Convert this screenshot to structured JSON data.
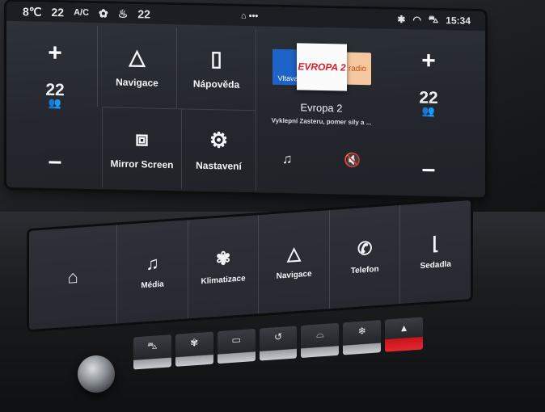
{
  "status_bar": {
    "outside_temp": "8℃",
    "left_temp": "22",
    "ac_label": "A/C",
    "fan_icon": "fan-icon",
    "seat_heat_icon": "seat-heat-icon",
    "right_temp": "22",
    "home_icon": "home-icon",
    "page_dots": "•••",
    "bluetooth_icon": "bluetooth-icon",
    "wifi_icon": "wifi-icon",
    "car_icon": "car-icon",
    "clock": "15:34"
  },
  "climate_left": {
    "plus": "+",
    "temp": "22",
    "persons_icon": "persons-icon",
    "minus": "–"
  },
  "climate_right": {
    "plus": "+",
    "temp": "22",
    "persons_icon": "persons-icon",
    "minus": "–"
  },
  "tiles": [
    {
      "label": "Navigace",
      "icon": "navigation-arrow-icon"
    },
    {
      "label": "Nápověda",
      "icon": "help-book-icon"
    },
    {
      "label": "Mirror Screen",
      "icon": "mirror-screen-icon"
    },
    {
      "label": "Nastavení",
      "icon": "gear-icon"
    }
  ],
  "media": {
    "logo_left": "Vltava",
    "logo_center": "EVROPA 2",
    "logo_right": "radio",
    "station": "Evropa 2",
    "track": "Vyklepní Zasteru, pomer sily a ...",
    "source_icon": "music-source-icon",
    "mute_icon": "mute-icon"
  },
  "shortcut_bar": [
    {
      "label": "",
      "icon": "home-icon"
    },
    {
      "label": "Média",
      "icon": "music-note-icon"
    },
    {
      "label": "Klimatizace",
      "icon": "fan-icon"
    },
    {
      "label": "Navigace",
      "icon": "navigation-arrow-icon"
    },
    {
      "label": "Telefon",
      "icon": "phone-icon"
    },
    {
      "label": "Sedadla",
      "icon": "seat-icon"
    }
  ],
  "physical_keys": [
    "car-icon",
    "fan-heat-icon",
    "rear-defrost-icon",
    "car-recirculation-icon",
    "front-defrost-icon",
    "ac-icon",
    "hazard-icon"
  ]
}
